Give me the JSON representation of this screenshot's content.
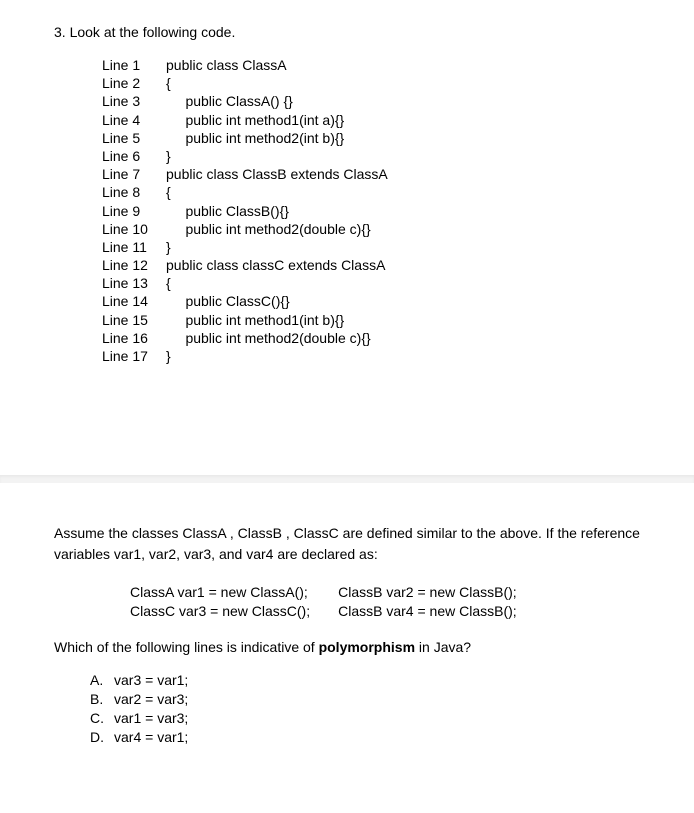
{
  "question_title": "3. Look at the following code.",
  "code_lines": [
    {
      "label": "Line 1",
      "content": "public class ClassA"
    },
    {
      "label": "Line 2",
      "content": "{"
    },
    {
      "label": "Line 3",
      "content": "     public ClassA() {}"
    },
    {
      "label": "Line 4",
      "content": "     public int method1(int a){}"
    },
    {
      "label": "Line 5",
      "content": "     public int method2(int b){}"
    },
    {
      "label": "Line 6",
      "content": "}"
    },
    {
      "label": "",
      "content": ""
    },
    {
      "label": "Line 7",
      "content": "public class ClassB extends ClassA"
    },
    {
      "label": "Line 8",
      "content": "{"
    },
    {
      "label": "Line 9",
      "content": "     public ClassB(){}"
    },
    {
      "label": "Line 10",
      "content": "     public int method2(double c){}"
    },
    {
      "label": "Line 11",
      "content": "}"
    },
    {
      "label": "",
      "content": ""
    },
    {
      "label": "Line 12",
      "content": "public class classC extends ClassA"
    },
    {
      "label": "Line 13",
      "content": "{"
    },
    {
      "label": "Line 14",
      "content": "     public ClassC(){}"
    },
    {
      "label": "Line 15",
      "content": "     public int method1(int b){}"
    },
    {
      "label": "Line 16",
      "content": "     public int method2(double c){}"
    },
    {
      "label": "Line 17",
      "content": "}"
    }
  ],
  "assume_text_prefix": "Assume the classes ",
  "assume_classes": "ClassA , ClassB , ClassC",
  "assume_text_mid": " are defined similar to the above. If the reference variables ",
  "assume_vars": "var1, var2, var3, and var4",
  "assume_text_suffix": " are declared as:",
  "var_declarations": {
    "col1": "ClassA var1 = new ClassA();\nClassC var3 = new ClassC();",
    "col2": "ClassB var2 = new ClassB();\nClassB var4 = new ClassB();"
  },
  "which_text_prefix": "Which of the following lines is indicative of ",
  "which_bold": "polymorphism",
  "which_text_suffix": " in Java?",
  "answers": [
    {
      "letter": "A.",
      "text": "var3 = var1;"
    },
    {
      "letter": "B.",
      "text": "var2 = var3;"
    },
    {
      "letter": "C.",
      "text": "var1 = var3;"
    },
    {
      "letter": "D.",
      "text": "var4 = var1;"
    }
  ]
}
